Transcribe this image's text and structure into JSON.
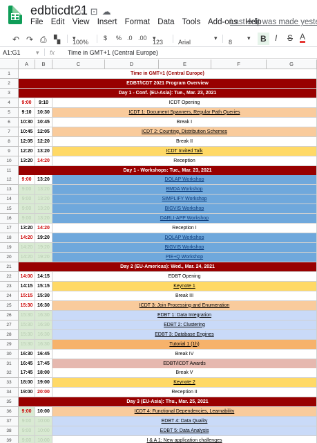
{
  "app": {
    "doc_title": "edbticdt21",
    "menu": [
      "File",
      "Edit",
      "View",
      "Insert",
      "Format",
      "Data",
      "Tools",
      "Add-ons",
      "Help"
    ],
    "last_edit": "Last edit was made yesterday at"
  },
  "toolbar": {
    "zoom": "100%",
    "currency": "$",
    "percent": "%",
    "dec_less": ".0",
    "dec_more": ".00",
    "format_more": "123",
    "font": "Arial",
    "font_size": "8",
    "bold": "B",
    "italic": "I",
    "strike": "S",
    "text_color": "A"
  },
  "formula_bar": {
    "cell_ref": "A1:G1",
    "fx": "fx",
    "content": "Time in GMT+1 (Central Europe)"
  },
  "colors": {
    "header_red": "#980000",
    "blue": "#6fa8dc",
    "orange": "#f9cb9c",
    "yellow": "#ffd966",
    "lightblue": "#c9daf8",
    "green": "#d9ead3",
    "pink": "#e6b8af",
    "deep_orange": "#f6b26b"
  },
  "columns": [
    "A",
    "B",
    "C",
    "D",
    "E",
    "F",
    "G"
  ],
  "rows": [
    {
      "n": "1",
      "type": "title",
      "text": "Time in GMT+1 (Central Europe)"
    },
    {
      "n": "2",
      "type": "section",
      "text": "EDBT/ICDT 2021 Program Overview"
    },
    {
      "n": "3",
      "type": "section",
      "text": "Day 1 - Conf. (EU-Asia): Tue., Mar. 23, 2021"
    },
    {
      "n": "4",
      "start": "9:00",
      "end": "9:10",
      "s_red": true,
      "bg": "white",
      "text": "ICDT Opening"
    },
    {
      "n": "5",
      "start": "9:10",
      "end": "10:30",
      "bg": "orange",
      "text": "ICDT 1: Document Spanners, Regular Path Queries",
      "u": true
    },
    {
      "n": "6",
      "start": "10:30",
      "end": "10:45",
      "bg": "white",
      "text": "Break I"
    },
    {
      "n": "7",
      "start": "10:45",
      "end": "12:05",
      "bg": "orange",
      "text": "ICDT 2: Counting, Distribution Schemes",
      "u": true
    },
    {
      "n": "8",
      "start": "12:05",
      "end": "12:20",
      "bg": "white",
      "text": "Break II"
    },
    {
      "n": "9",
      "start": "12:20",
      "end": "13:20",
      "bg": "yellow",
      "text": "ICDT Invited Talk",
      "u": true
    },
    {
      "n": "10",
      "start": "13:20",
      "end": "14:20",
      "e_red": true,
      "bg": "white",
      "text": "Reception"
    },
    {
      "n": "11",
      "type": "section",
      "text": "Day 1 - Workshops: Tue., Mar. 23, 2021"
    },
    {
      "n": "12",
      "start": "9:00",
      "end": "13:20",
      "s_red": true,
      "bg": "blue",
      "text": "DOLAP Workshop",
      "u": true
    },
    {
      "n": "13",
      "start": "9:00",
      "end": "13:20",
      "faded": true,
      "bg": "blue",
      "text": "BMDA Workshop",
      "u": true
    },
    {
      "n": "14",
      "start": "9:00",
      "end": "13:20",
      "faded": true,
      "bg": "blue",
      "text": "SIMPLIFY Workshop",
      "u": true
    },
    {
      "n": "15",
      "start": "9:00",
      "end": "13:20",
      "faded": true,
      "bg": "blue",
      "text": "BIGVIS Workshop",
      "u": true
    },
    {
      "n": "16",
      "start": "9:00",
      "end": "13:20",
      "faded": true,
      "bg": "blue",
      "text": "DARLI-APP Workshop",
      "u": true
    },
    {
      "n": "17",
      "start": "13:20",
      "end": "14:20",
      "e_red": true,
      "bg": "white",
      "text": "Reception I"
    },
    {
      "n": "18",
      "start": "14:20",
      "end": "19:20",
      "s_red": true,
      "bg": "blue",
      "text": "DOLAP Workshop",
      "u": true
    },
    {
      "n": "19",
      "start": "14:20",
      "end": "19:20",
      "faded": true,
      "bg": "blue",
      "text": "BIGVIS Workshop",
      "u": true
    },
    {
      "n": "20",
      "start": "14:20",
      "end": "19:20",
      "faded": true,
      "bg": "blue",
      "text": "PIE+Q Workshop",
      "u": true
    },
    {
      "n": "21",
      "type": "section",
      "text": "Day 2 (EU-Americas): Wed., Mar. 24, 2021"
    },
    {
      "n": "22",
      "start": "14:00",
      "end": "14:15",
      "s_red": true,
      "bg": "white",
      "text": "EDBT Opening"
    },
    {
      "n": "23",
      "start": "14:15",
      "end": "15:15",
      "bg": "yellow",
      "text": "Keynote 1",
      "u": true
    },
    {
      "n": "24",
      "start": "15:15",
      "end": "15:30",
      "s_red": true,
      "bg": "white",
      "text": "Break III"
    },
    {
      "n": "25",
      "start": "15:30",
      "end": "16:30",
      "s_red": true,
      "bg": "orange",
      "text": "ICDT 3: Join Processing and Enumeration",
      "u": true
    },
    {
      "n": "26",
      "start": "15:30",
      "end": "16:30",
      "faded": true,
      "bg": "lightblue",
      "text": "EDBT 1: Data Integration",
      "u": true
    },
    {
      "n": "27",
      "start": "15:30",
      "end": "16:30",
      "faded": true,
      "bg": "lightblue",
      "text": "EDBT 2: Clustering",
      "u": true
    },
    {
      "n": "28",
      "start": "15:30",
      "end": "16:30",
      "faded": true,
      "bg": "lightblue",
      "text": "EDBT 3: Database Engines",
      "u": true
    },
    {
      "n": "29",
      "start": "15:30",
      "end": "16:30",
      "faded": true,
      "bg": "deep_orange",
      "text": "Tutorial 1 (1h)",
      "u": true
    },
    {
      "n": "30",
      "start": "16:30",
      "end": "16:45",
      "bg": "white",
      "text": "Break IV"
    },
    {
      "n": "31",
      "start": "16:45",
      "end": "17:45",
      "bg": "pink",
      "text": "EDBT/ICDT Awards"
    },
    {
      "n": "32",
      "start": "17:45",
      "end": "18:00",
      "bg": "white",
      "text": "Break V"
    },
    {
      "n": "33",
      "start": "18:00",
      "end": "19:00",
      "bg": "yellow",
      "text": "Keynote 2",
      "u": true
    },
    {
      "n": "34",
      "start": "19:00",
      "end": "20:00",
      "e_red": true,
      "bg": "white",
      "text": "Reception II"
    },
    {
      "n": "35",
      "type": "section",
      "text": "Day 3 (EU-Asia): Thu., Mar. 25, 2021"
    },
    {
      "n": "36",
      "start": "9:00",
      "end": "10:00",
      "s_red": true,
      "green": true,
      "bg": "orange",
      "text": "ICDT 4: Functional Dependencies, Learnability",
      "u": true
    },
    {
      "n": "37",
      "start": "9:00",
      "end": "10:00",
      "faded": true,
      "bg": "lightblue",
      "text": "EDBT 4: Data Quality",
      "u": true
    },
    {
      "n": "38",
      "start": "9:00",
      "end": "10:00",
      "faded": true,
      "bg": "lightblue",
      "text": "EDBT 5: Data Analysis",
      "u": true
    },
    {
      "n": "39",
      "start": "9:00",
      "end": "10:00",
      "faded": true,
      "bg": "white",
      "text": "I & A 1: New application challenges",
      "u": true
    }
  ]
}
